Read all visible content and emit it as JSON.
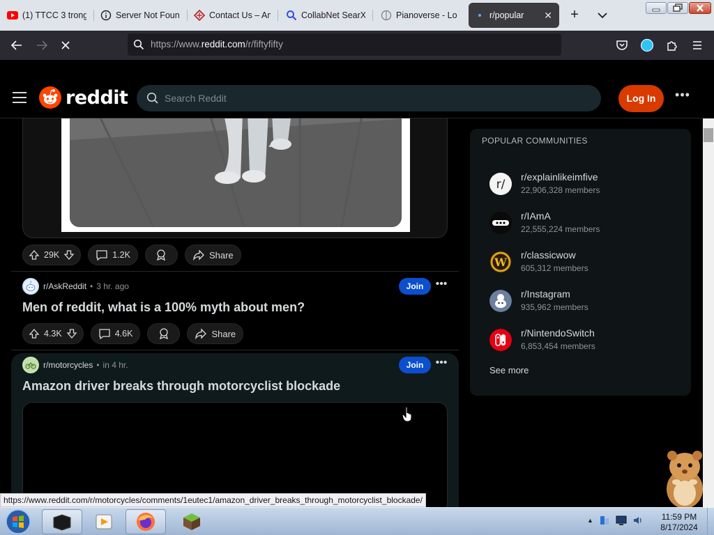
{
  "browser": {
    "tabs": [
      {
        "label": "(1) TTCC 3 trong",
        "icon": "youtube-icon",
        "active": false
      },
      {
        "label": "Server Not Found",
        "icon": "info-icon",
        "active": false
      },
      {
        "label": "Contact Us – Am",
        "icon": "site-icon",
        "active": false
      },
      {
        "label": "CollabNet SearX",
        "icon": "search-icon",
        "active": false
      },
      {
        "label": "Pianoverse - Lob",
        "icon": "page-icon",
        "active": false
      },
      {
        "label": "r/popular",
        "icon": "loading-dot-icon",
        "active": true
      }
    ],
    "url_prefix": "https://www.",
    "url_domain": "reddit.com",
    "url_path": "/r/fiftyfifty",
    "status_url": "https://www.reddit.com/r/motorcycles/comments/1eutec1/amazon_driver_breaks_through_motorcyclist_blockade/"
  },
  "reddit": {
    "wordmark": "reddit",
    "search_placeholder": "Search Reddit",
    "login_label": "Log In",
    "more_label": "•••",
    "top_post": {
      "upvotes": "29K",
      "comments": "1.2K",
      "share_label": "Share"
    },
    "posts": [
      {
        "subreddit": "r/AskReddit",
        "time": "3 hr. ago",
        "join_label": "Join",
        "title": "Men of reddit, what is a 100% myth about men?",
        "upvotes": "4.3K",
        "comments": "4.6K",
        "share_label": "Share"
      },
      {
        "subreddit": "r/motorcycles",
        "time": "in 4 hr.",
        "join_label": "Join",
        "title": "Amazon driver breaks through motorcyclist blockade"
      }
    ],
    "sidebar": {
      "heading": "POPULAR COMMUNITIES",
      "communities": [
        {
          "name": "r/explainlikeimfive",
          "members": "22,906,328 members"
        },
        {
          "name": "r/IAmA",
          "members": "22,555,224 members"
        },
        {
          "name": "r/classicwow",
          "members": "605,312 members"
        },
        {
          "name": "r/Instagram",
          "members": "935,962 members"
        },
        {
          "name": "r/NintendoSwitch",
          "members": "6,853,454 members"
        }
      ],
      "see_more": "See more"
    }
  },
  "taskbar": {
    "time": "11:59 PM",
    "date": "8/17/2024"
  },
  "colors": {
    "reddit_orange": "#d93a00",
    "join_blue": "#0b4fce",
    "background": "#000000"
  }
}
